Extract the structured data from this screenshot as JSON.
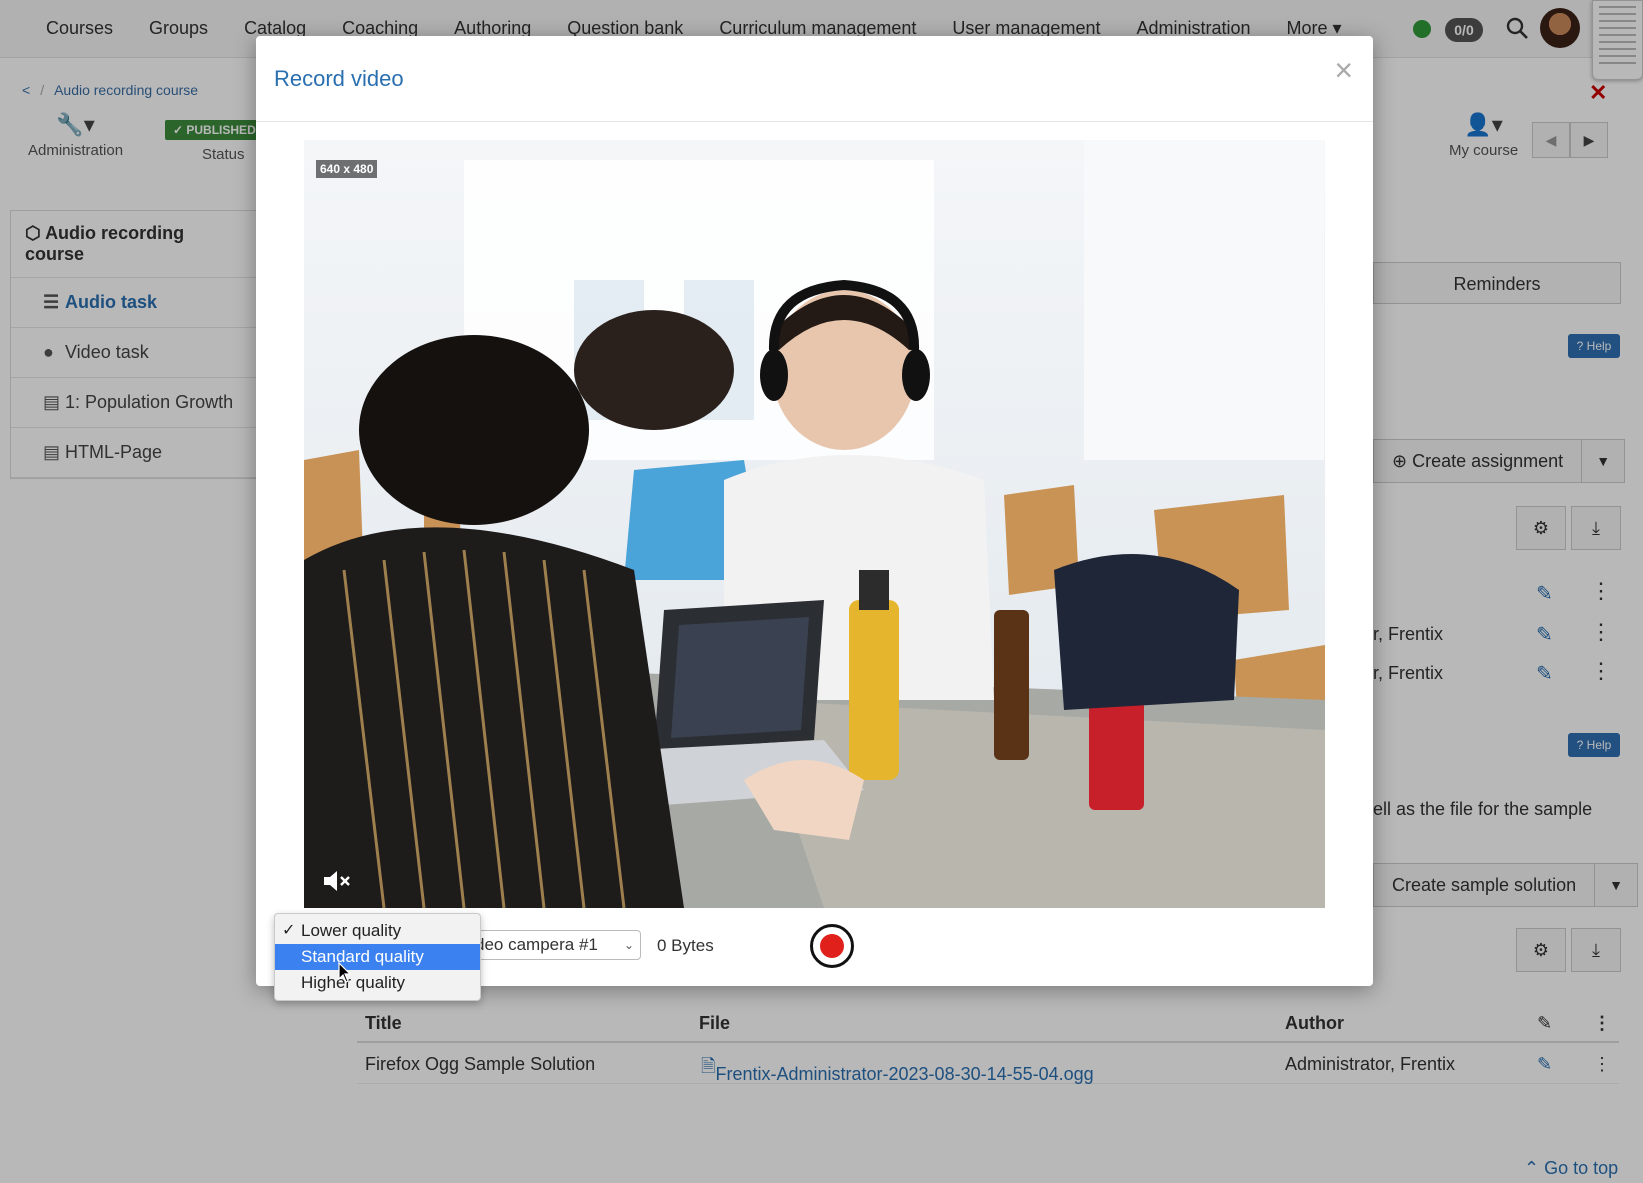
{
  "topnav": {
    "items": [
      "Courses",
      "Groups",
      "Catalog",
      "Coaching",
      "Authoring",
      "Question bank",
      "Curriculum management",
      "User management",
      "Administration",
      "More ▾"
    ],
    "counter": "0/0"
  },
  "breadcrumb": {
    "back": "<",
    "course": "Audio recording course"
  },
  "toolbar": {
    "administration": "Administration",
    "status": "Status",
    "published": "✓ PUBLISHED",
    "my_course": "My course"
  },
  "sidebar": {
    "title": "Audio recording course",
    "items": [
      {
        "label": "Audio task",
        "icon": "list-icon"
      },
      {
        "label": "Video task",
        "icon": "play-circle-icon"
      },
      {
        "label": "1: Population Growth",
        "icon": "document-icon"
      },
      {
        "label": "HTML-Page",
        "icon": "document-icon"
      }
    ]
  },
  "main": {
    "reminders_tab": "Reminders",
    "help": "Help",
    "create_assignment": "Create assignment",
    "row1_author": "r, Frentix",
    "row2_author": "r, Frentix",
    "sample_text": "ell as the file for the sample",
    "create_sample_solution": "Create sample solution",
    "table": {
      "headers": [
        "Title",
        "File",
        "Author"
      ],
      "rows": [
        {
          "title": "Firefox Ogg Sample Solution",
          "file": "Frentix-Administrator-2023-08-30-14-55-04.ogg",
          "author": "Administrator, Frentix"
        }
      ]
    },
    "go_to_top": "Go to top"
  },
  "modal": {
    "title": "Record video",
    "resolution": "640 x 480",
    "camera": "deo campera #1",
    "bytes": "0 Bytes",
    "quality_options": [
      {
        "label": "Lower quality",
        "checked": true,
        "highlighted": false
      },
      {
        "label": "Standard quality",
        "checked": false,
        "highlighted": true
      },
      {
        "label": "Higher quality",
        "checked": false,
        "highlighted": false
      }
    ]
  },
  "colors": {
    "accent": "#2a6fb0",
    "record_red": "#e0201b",
    "published_green": "#3c8d3c",
    "menu_highlight": "#3b82f0"
  }
}
